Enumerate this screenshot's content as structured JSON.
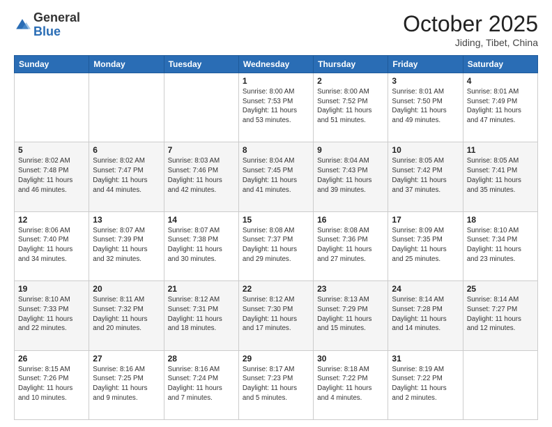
{
  "logo": {
    "general": "General",
    "blue": "Blue"
  },
  "header": {
    "month": "October 2025",
    "location": "Jiding, Tibet, China"
  },
  "weekdays": [
    "Sunday",
    "Monday",
    "Tuesday",
    "Wednesday",
    "Thursday",
    "Friday",
    "Saturday"
  ],
  "weeks": [
    [
      {
        "day": "",
        "sunrise": "",
        "sunset": "",
        "daylight": ""
      },
      {
        "day": "",
        "sunrise": "",
        "sunset": "",
        "daylight": ""
      },
      {
        "day": "",
        "sunrise": "",
        "sunset": "",
        "daylight": ""
      },
      {
        "day": "1",
        "sunrise": "Sunrise: 8:00 AM",
        "sunset": "Sunset: 7:53 PM",
        "daylight": "Daylight: 11 hours and 53 minutes."
      },
      {
        "day": "2",
        "sunrise": "Sunrise: 8:00 AM",
        "sunset": "Sunset: 7:52 PM",
        "daylight": "Daylight: 11 hours and 51 minutes."
      },
      {
        "day": "3",
        "sunrise": "Sunrise: 8:01 AM",
        "sunset": "Sunset: 7:50 PM",
        "daylight": "Daylight: 11 hours and 49 minutes."
      },
      {
        "day": "4",
        "sunrise": "Sunrise: 8:01 AM",
        "sunset": "Sunset: 7:49 PM",
        "daylight": "Daylight: 11 hours and 47 minutes."
      }
    ],
    [
      {
        "day": "5",
        "sunrise": "Sunrise: 8:02 AM",
        "sunset": "Sunset: 7:48 PM",
        "daylight": "Daylight: 11 hours and 46 minutes."
      },
      {
        "day": "6",
        "sunrise": "Sunrise: 8:02 AM",
        "sunset": "Sunset: 7:47 PM",
        "daylight": "Daylight: 11 hours and 44 minutes."
      },
      {
        "day": "7",
        "sunrise": "Sunrise: 8:03 AM",
        "sunset": "Sunset: 7:46 PM",
        "daylight": "Daylight: 11 hours and 42 minutes."
      },
      {
        "day": "8",
        "sunrise": "Sunrise: 8:04 AM",
        "sunset": "Sunset: 7:45 PM",
        "daylight": "Daylight: 11 hours and 41 minutes."
      },
      {
        "day": "9",
        "sunrise": "Sunrise: 8:04 AM",
        "sunset": "Sunset: 7:43 PM",
        "daylight": "Daylight: 11 hours and 39 minutes."
      },
      {
        "day": "10",
        "sunrise": "Sunrise: 8:05 AM",
        "sunset": "Sunset: 7:42 PM",
        "daylight": "Daylight: 11 hours and 37 minutes."
      },
      {
        "day": "11",
        "sunrise": "Sunrise: 8:05 AM",
        "sunset": "Sunset: 7:41 PM",
        "daylight": "Daylight: 11 hours and 35 minutes."
      }
    ],
    [
      {
        "day": "12",
        "sunrise": "Sunrise: 8:06 AM",
        "sunset": "Sunset: 7:40 PM",
        "daylight": "Daylight: 11 hours and 34 minutes."
      },
      {
        "day": "13",
        "sunrise": "Sunrise: 8:07 AM",
        "sunset": "Sunset: 7:39 PM",
        "daylight": "Daylight: 11 hours and 32 minutes."
      },
      {
        "day": "14",
        "sunrise": "Sunrise: 8:07 AM",
        "sunset": "Sunset: 7:38 PM",
        "daylight": "Daylight: 11 hours and 30 minutes."
      },
      {
        "day": "15",
        "sunrise": "Sunrise: 8:08 AM",
        "sunset": "Sunset: 7:37 PM",
        "daylight": "Daylight: 11 hours and 29 minutes."
      },
      {
        "day": "16",
        "sunrise": "Sunrise: 8:08 AM",
        "sunset": "Sunset: 7:36 PM",
        "daylight": "Daylight: 11 hours and 27 minutes."
      },
      {
        "day": "17",
        "sunrise": "Sunrise: 8:09 AM",
        "sunset": "Sunset: 7:35 PM",
        "daylight": "Daylight: 11 hours and 25 minutes."
      },
      {
        "day": "18",
        "sunrise": "Sunrise: 8:10 AM",
        "sunset": "Sunset: 7:34 PM",
        "daylight": "Daylight: 11 hours and 23 minutes."
      }
    ],
    [
      {
        "day": "19",
        "sunrise": "Sunrise: 8:10 AM",
        "sunset": "Sunset: 7:33 PM",
        "daylight": "Daylight: 11 hours and 22 minutes."
      },
      {
        "day": "20",
        "sunrise": "Sunrise: 8:11 AM",
        "sunset": "Sunset: 7:32 PM",
        "daylight": "Daylight: 11 hours and 20 minutes."
      },
      {
        "day": "21",
        "sunrise": "Sunrise: 8:12 AM",
        "sunset": "Sunset: 7:31 PM",
        "daylight": "Daylight: 11 hours and 18 minutes."
      },
      {
        "day": "22",
        "sunrise": "Sunrise: 8:12 AM",
        "sunset": "Sunset: 7:30 PM",
        "daylight": "Daylight: 11 hours and 17 minutes."
      },
      {
        "day": "23",
        "sunrise": "Sunrise: 8:13 AM",
        "sunset": "Sunset: 7:29 PM",
        "daylight": "Daylight: 11 hours and 15 minutes."
      },
      {
        "day": "24",
        "sunrise": "Sunrise: 8:14 AM",
        "sunset": "Sunset: 7:28 PM",
        "daylight": "Daylight: 11 hours and 14 minutes."
      },
      {
        "day": "25",
        "sunrise": "Sunrise: 8:14 AM",
        "sunset": "Sunset: 7:27 PM",
        "daylight": "Daylight: 11 hours and 12 minutes."
      }
    ],
    [
      {
        "day": "26",
        "sunrise": "Sunrise: 8:15 AM",
        "sunset": "Sunset: 7:26 PM",
        "daylight": "Daylight: 11 hours and 10 minutes."
      },
      {
        "day": "27",
        "sunrise": "Sunrise: 8:16 AM",
        "sunset": "Sunset: 7:25 PM",
        "daylight": "Daylight: 11 hours and 9 minutes."
      },
      {
        "day": "28",
        "sunrise": "Sunrise: 8:16 AM",
        "sunset": "Sunset: 7:24 PM",
        "daylight": "Daylight: 11 hours and 7 minutes."
      },
      {
        "day": "29",
        "sunrise": "Sunrise: 8:17 AM",
        "sunset": "Sunset: 7:23 PM",
        "daylight": "Daylight: 11 hours and 5 minutes."
      },
      {
        "day": "30",
        "sunrise": "Sunrise: 8:18 AM",
        "sunset": "Sunset: 7:22 PM",
        "daylight": "Daylight: 11 hours and 4 minutes."
      },
      {
        "day": "31",
        "sunrise": "Sunrise: 8:19 AM",
        "sunset": "Sunset: 7:22 PM",
        "daylight": "Daylight: 11 hours and 2 minutes."
      },
      {
        "day": "",
        "sunrise": "",
        "sunset": "",
        "daylight": ""
      }
    ]
  ]
}
